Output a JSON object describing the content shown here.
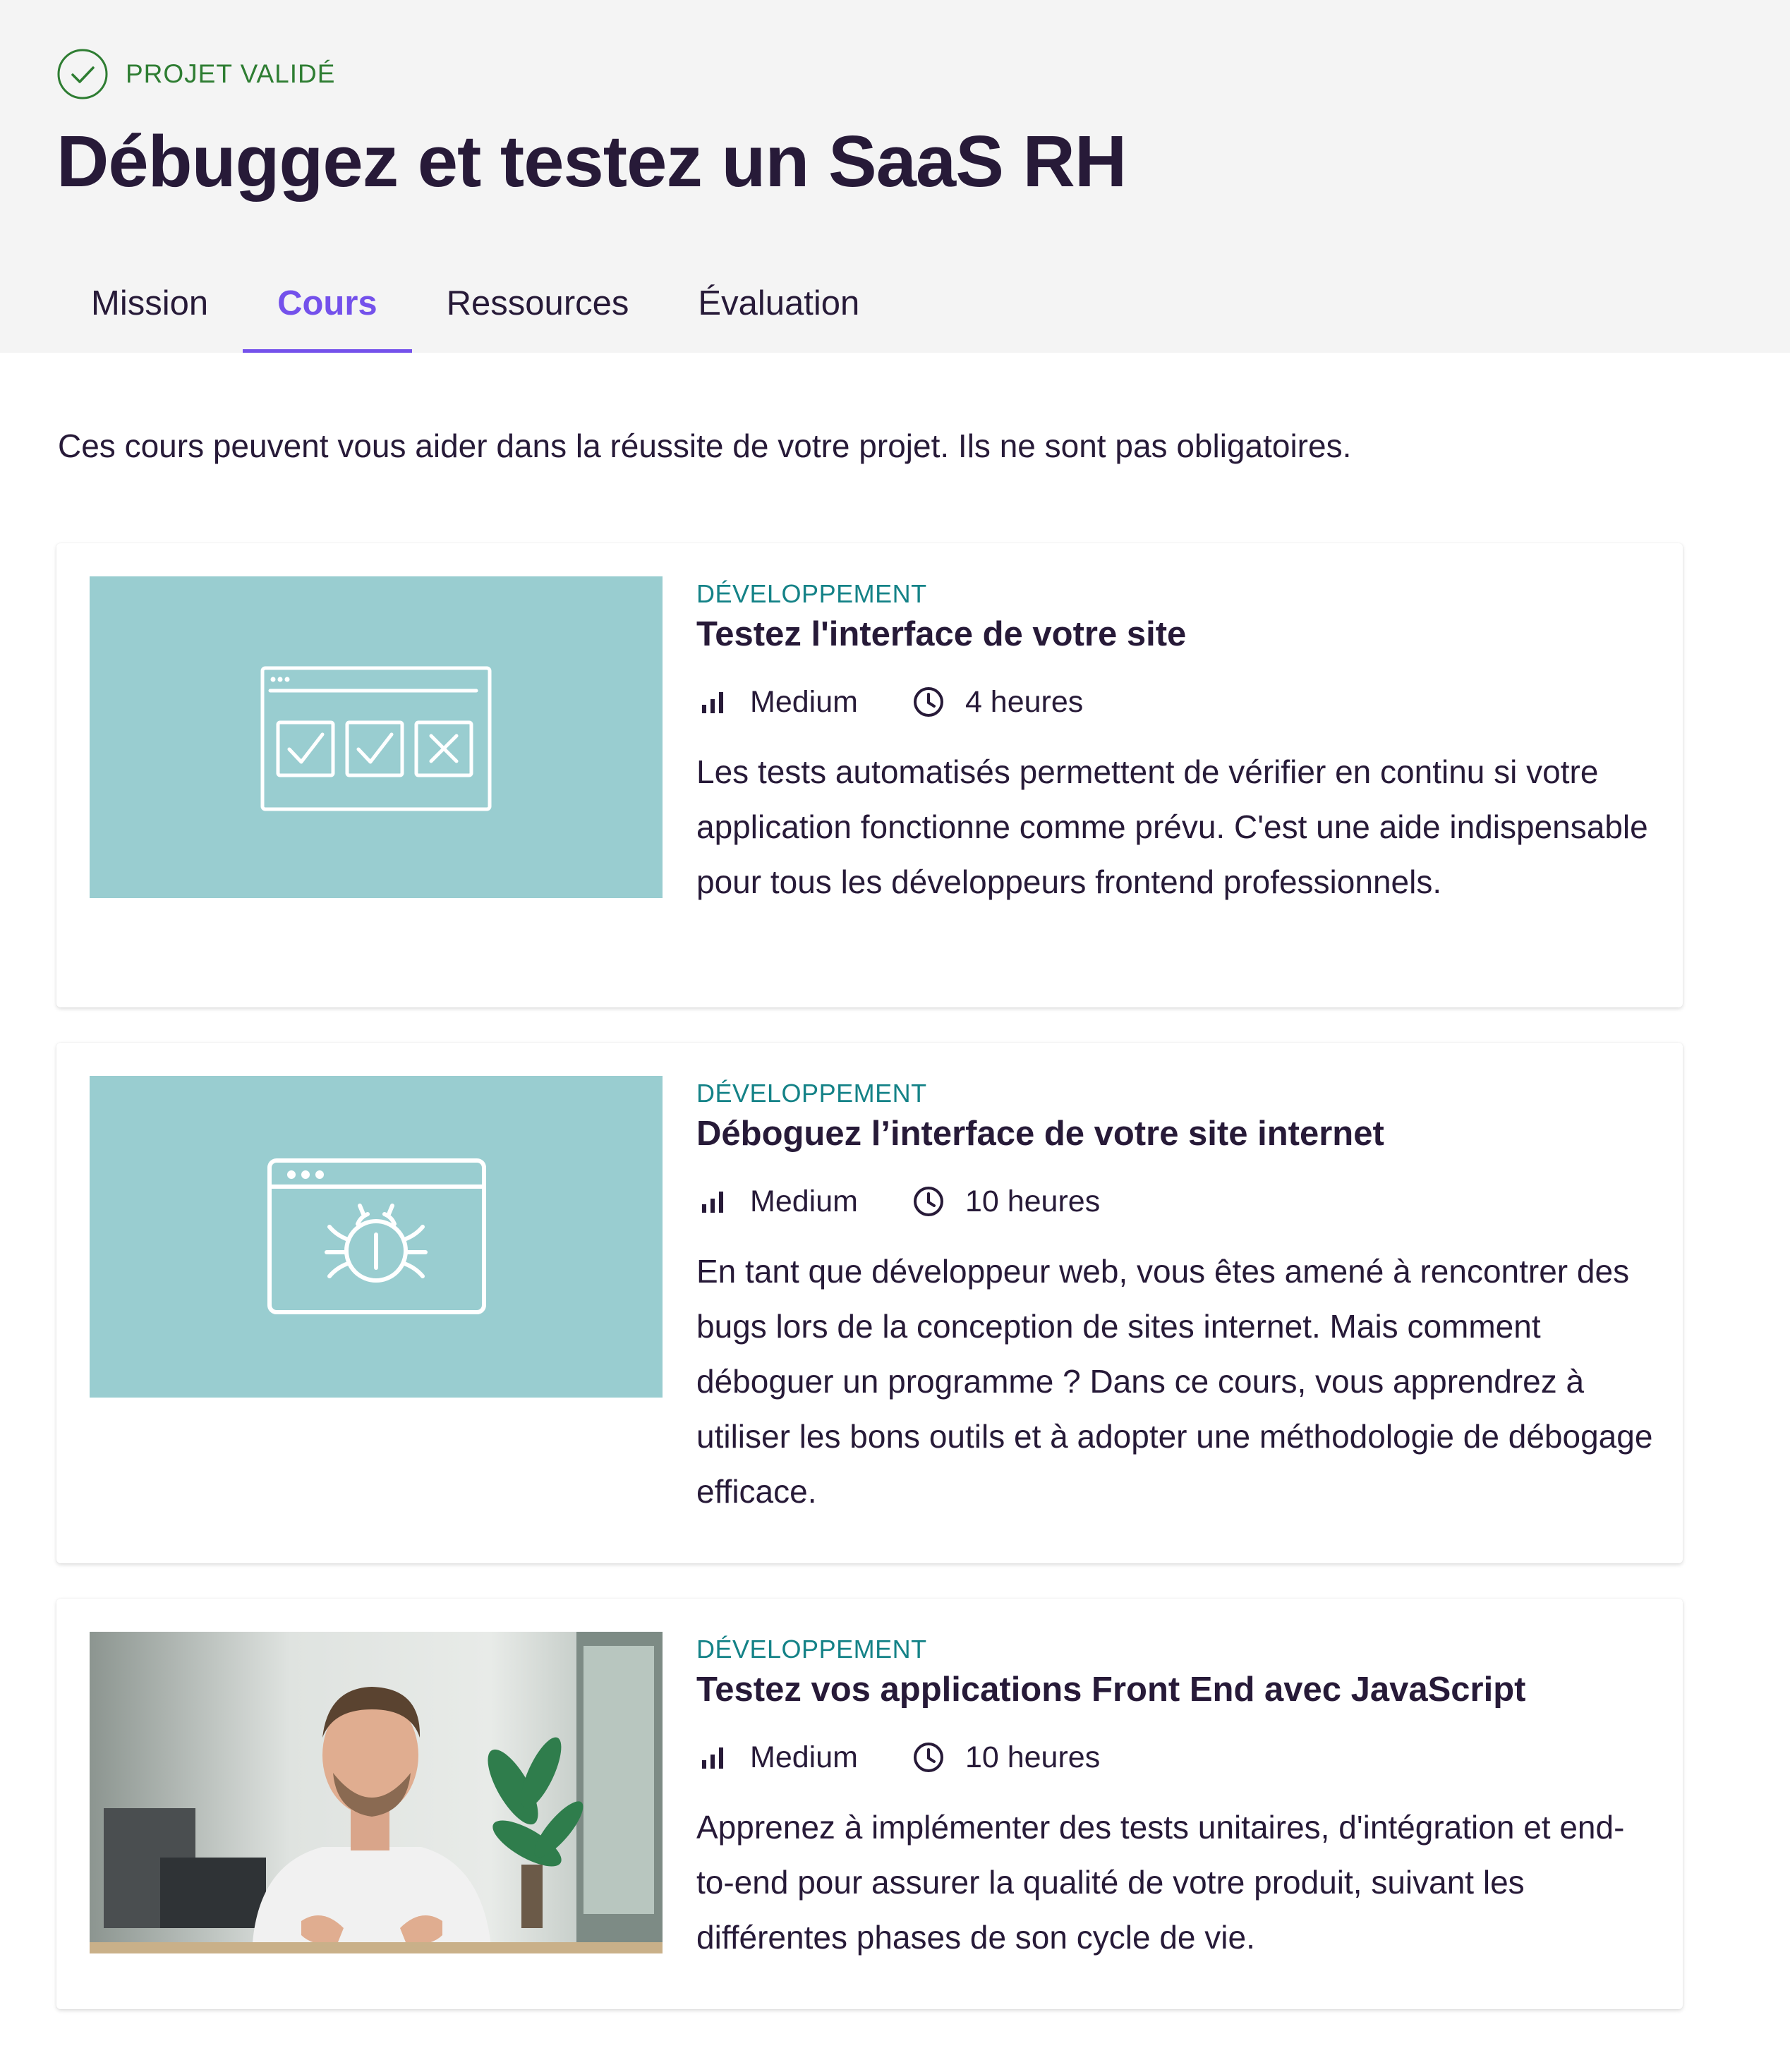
{
  "header": {
    "status_label": "PROJET VALIDÉ",
    "title": "Débuggez et testez un SaaS RH"
  },
  "tabs": [
    {
      "label": "Mission",
      "active": false
    },
    {
      "label": "Cours",
      "active": true
    },
    {
      "label": "Ressources",
      "active": false
    },
    {
      "label": "Évaluation",
      "active": false
    }
  ],
  "intro": "Ces cours peuvent vous aider dans la réussite de votre projet. Ils ne sont pas obligatoires.",
  "courses": [
    {
      "category": "DÉVELOPPEMENT",
      "title": "Testez l'interface de votre site",
      "level": "Medium",
      "duration": "4 heures",
      "description": "Les tests automatisés permettent de vérifier en continu si votre application fonctionne comme prévu. C'est une aide indispensable pour tous les développeurs frontend professionnels.",
      "thumbnail": "browser-checklist-icon"
    },
    {
      "category": "DÉVELOPPEMENT",
      "title": "Déboguez l’interface de votre site internet",
      "level": "Medium",
      "duration": "10 heures",
      "description": "En tant que développeur web, vous êtes amené à rencontrer des bugs lors de la conception de sites internet. Mais comment déboguer un programme ? Dans ce cours, vous apprendrez à utiliser les bons outils et à adopter une méthodologie de débogage efficace.",
      "thumbnail": "browser-bug-icon"
    },
    {
      "category": "DÉVELOPPEMENT",
      "title": "Testez vos applications Front End avec JavaScript",
      "level": "Medium",
      "duration": "10 heures",
      "description": "Apprenez à implémenter des tests unitaires, d'intégration et end-to-end pour assurer la qualité de votre produit, suivant les différentes phases de son cycle de vie.",
      "thumbnail": "instructor-photo"
    }
  ],
  "colors": {
    "accent": "#7451eb",
    "success": "#2e7d32",
    "category": "#148287",
    "thumbnail_bg": "#99cdd0",
    "text": "#271a38"
  }
}
